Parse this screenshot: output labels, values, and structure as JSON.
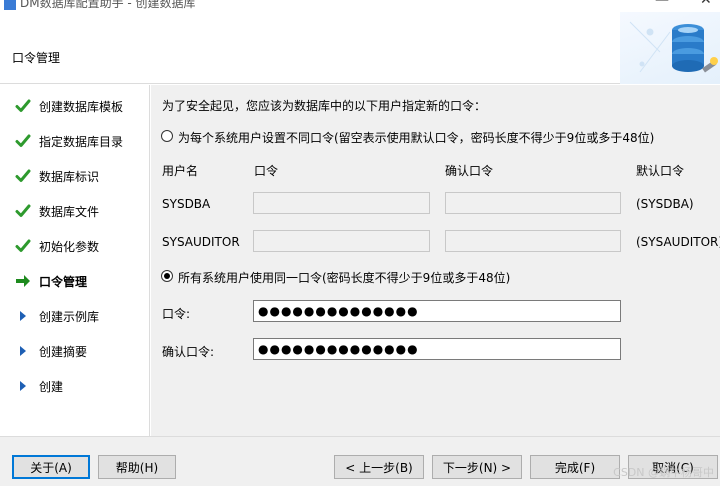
{
  "window": {
    "title": "DM数据库配置助手 - 创建数据库"
  },
  "header": {
    "page_title": "口令管理"
  },
  "sidebar": {
    "steps": [
      {
        "label": "创建数据库模板",
        "status": "done"
      },
      {
        "label": "指定数据库目录",
        "status": "done"
      },
      {
        "label": "数据库标识",
        "status": "done"
      },
      {
        "label": "数据库文件",
        "status": "done"
      },
      {
        "label": "初始化参数",
        "status": "done"
      },
      {
        "label": "口令管理",
        "status": "current"
      },
      {
        "label": "创建示例库",
        "status": "pending"
      },
      {
        "label": "创建摘要",
        "status": "pending"
      },
      {
        "label": "创建",
        "status": "pending"
      }
    ]
  },
  "main": {
    "intro": "为了安全起见，您应该为数据库中的以下用户指定新的口令：",
    "option_separate": "为每个系统用户设置不同口令(留空表示使用默认口令，密码长度不得少于9位或多于48位)",
    "columns": {
      "user": "用户名",
      "password": "口令",
      "confirm": "确认口令",
      "default": "默认口令"
    },
    "users": [
      {
        "name": "SYSDBA",
        "default": "(SYSDBA)"
      },
      {
        "name": "SYSAUDITOR",
        "default": "(SYSAUDITOR)"
      }
    ],
    "option_same": "所有系统用户使用同一口令(密码长度不得少于9位或多于48位)",
    "password_label": "口令:",
    "password_value": "●●●●●●●●●●●●●●",
    "confirm_label": "确认口令:",
    "confirm_value": "●●●●●●●●●●●●●●",
    "selected_option": "same"
  },
  "footer": {
    "about": "关于(A)",
    "help": "帮助(H)",
    "prev": "< 上一步(B)",
    "next": "下一步(N) >",
    "finish": "完成(F)",
    "cancel": "取消(C)",
    "watermark": "CSDN @蜗牛杨哥中"
  },
  "colors": {
    "check_green": "#2e9a2e",
    "arrow_green": "#1e8a1e",
    "pending_blue": "#1e5fb4",
    "focus_blue": "#0078d7"
  }
}
